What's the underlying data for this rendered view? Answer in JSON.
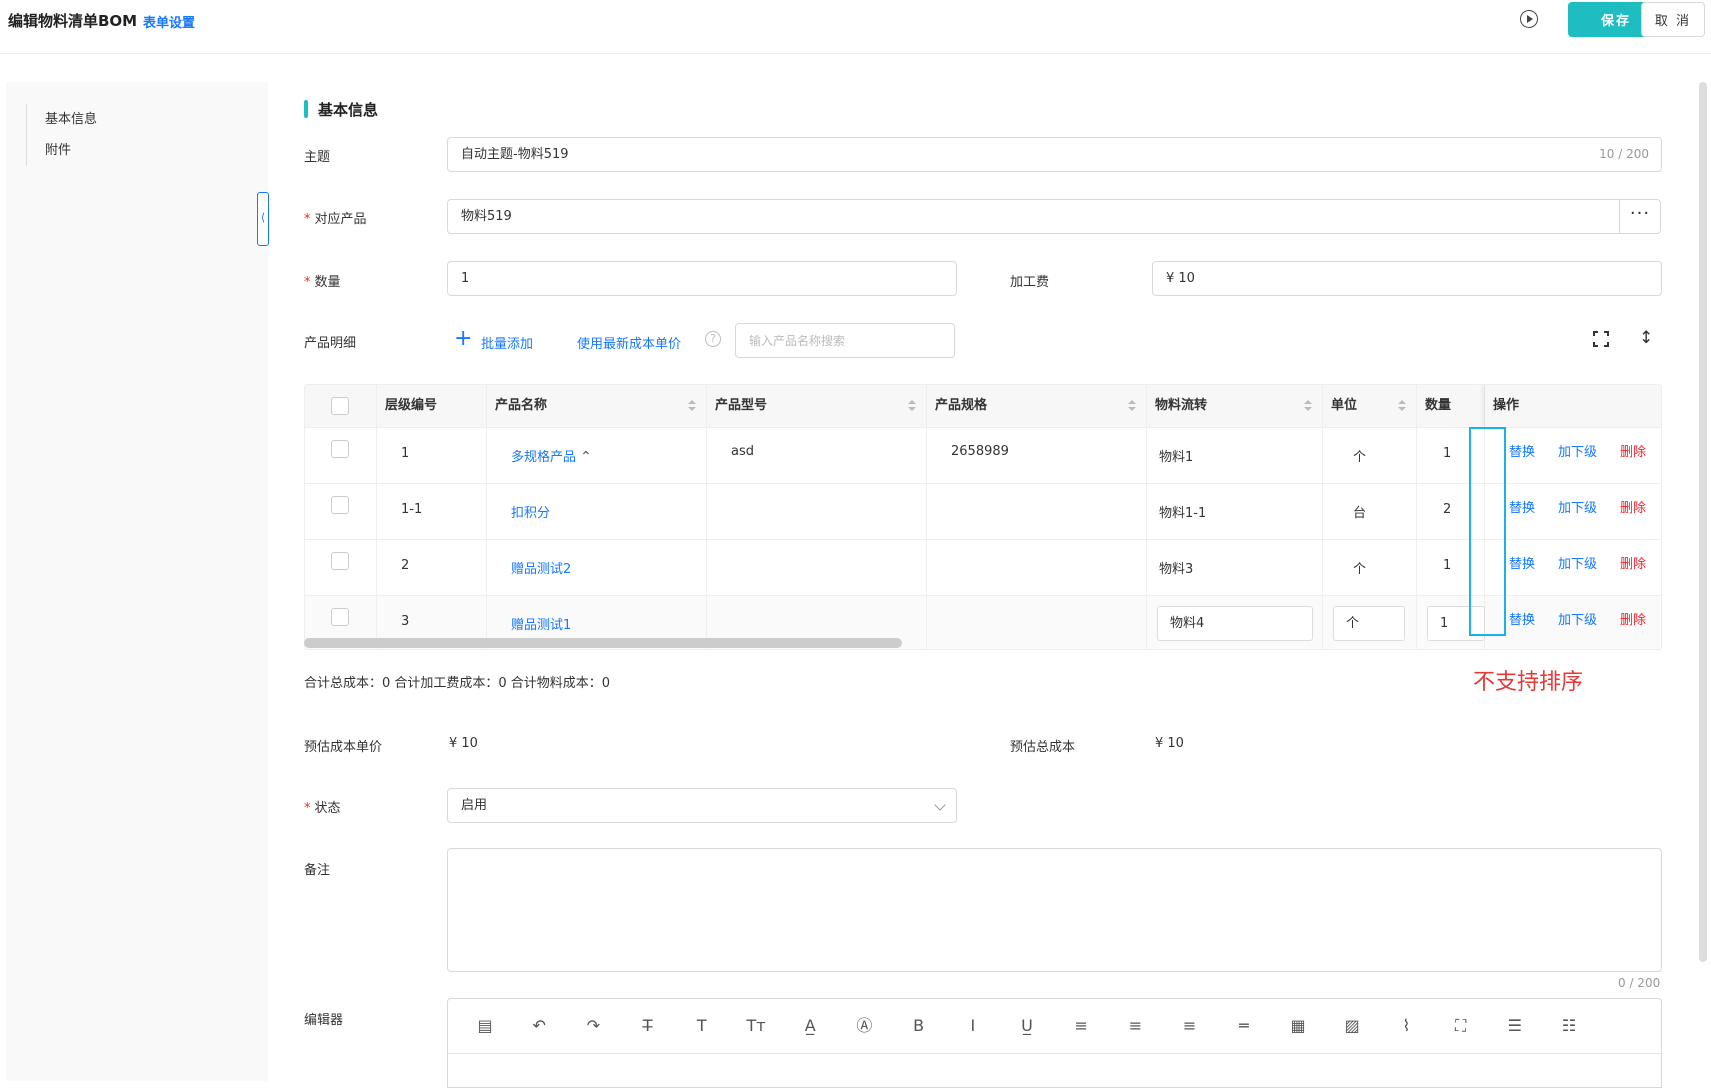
{
  "header": {
    "title": "编辑物料清单BOM",
    "form_settings": "表单设置",
    "save": "保存",
    "cancel": "取 消"
  },
  "sidebar": {
    "items": [
      {
        "label": "基本信息"
      },
      {
        "label": "附件"
      }
    ]
  },
  "section": {
    "title": "基本信息"
  },
  "form": {
    "subject": {
      "label": "主题",
      "value": "自动主题-物料519",
      "counter": "10 / 200"
    },
    "product": {
      "label": "对应产品",
      "value": "物料519",
      "more": "···"
    },
    "quantity": {
      "label": "数量",
      "value": "1"
    },
    "processing_fee": {
      "label": "加工费",
      "value": "¥ 10"
    },
    "detail": {
      "label": "产品明细",
      "batch_add": "批量添加",
      "use_latest_cost": "使用最新成本单价",
      "search_placeholder": "输入产品名称搜索",
      "help": "?"
    },
    "totals": "合计总成本：0   合计加工费成本：0   合计物料成本：0",
    "est_unit_cost": {
      "label": "预估成本单价",
      "value": "¥ 10"
    },
    "est_total_cost": {
      "label": "预估总成本",
      "value": "¥ 10"
    },
    "status": {
      "label": "状态",
      "value": "启用"
    },
    "remark": {
      "label": "备注",
      "counter": "0 / 200"
    },
    "editor": {
      "label": "编辑器"
    }
  },
  "table": {
    "headers": [
      "层级编号",
      "产品名称",
      "产品型号",
      "产品规格",
      "物料流转",
      "单位",
      "数量",
      "操作"
    ],
    "rows": [
      {
        "level": "1",
        "name": "多规格产品",
        "model": "asd",
        "spec": "2658989",
        "flow": "物料1",
        "unit": "个",
        "qty": "1"
      },
      {
        "level": "1-1",
        "name": "扣积分",
        "model": "",
        "spec": "",
        "flow": "物料1-1",
        "unit": "台",
        "qty": "2"
      },
      {
        "level": "2",
        "name": "赠品测试2",
        "model": "",
        "spec": "",
        "flow": "物料3",
        "unit": "个",
        "qty": "1"
      },
      {
        "level": "3",
        "name": "赠品测试1",
        "model": "",
        "spec": "",
        "flow": "物料4",
        "unit": "个",
        "qty": "1"
      }
    ],
    "ops": {
      "replace": "替换",
      "add_child": "加下级",
      "delete": "删除"
    }
  },
  "annotation": "不支持排序",
  "colors": {
    "accent": "#1ebdc2",
    "link": "#1677ff",
    "danger": "#f5222d",
    "annotation": "#e53935",
    "highlight": "#1ab3e8"
  },
  "icons": {
    "play": "play-circle-icon",
    "fullscreen": "fullscreen-icon",
    "resize": "vertical-resize-icon",
    "collapse": "chevron-left-icon",
    "expand_row": "double-chevron-up-icon"
  },
  "editor_tools": [
    {
      "name": "template-icon",
      "glyph": "▤"
    },
    {
      "name": "undo-icon",
      "glyph": "↶"
    },
    {
      "name": "redo-icon",
      "glyph": "↷"
    },
    {
      "name": "strikethrough-icon",
      "glyph": "T̶"
    },
    {
      "name": "text-icon",
      "glyph": "T"
    },
    {
      "name": "font-size-icon",
      "glyph": "Tт"
    },
    {
      "name": "font-color-icon",
      "glyph": "A̲"
    },
    {
      "name": "bg-color-icon",
      "glyph": "Ⓐ"
    },
    {
      "name": "bold-icon",
      "glyph": "B"
    },
    {
      "name": "italic-icon",
      "glyph": "I"
    },
    {
      "name": "underline-icon",
      "glyph": "U̲"
    },
    {
      "name": "align-left-icon",
      "glyph": "≡"
    },
    {
      "name": "align-center-icon",
      "glyph": "≡"
    },
    {
      "name": "align-right-icon",
      "glyph": "≡"
    },
    {
      "name": "hr-icon",
      "glyph": "═"
    },
    {
      "name": "table-icon",
      "glyph": "▦"
    },
    {
      "name": "image-icon",
      "glyph": "▨"
    },
    {
      "name": "attachment-icon",
      "glyph": "⌇"
    },
    {
      "name": "fullscreen-icon",
      "glyph": "⛶"
    },
    {
      "name": "ordered-list-icon",
      "glyph": "☰"
    },
    {
      "name": "unordered-list-icon",
      "glyph": "☷"
    }
  ]
}
